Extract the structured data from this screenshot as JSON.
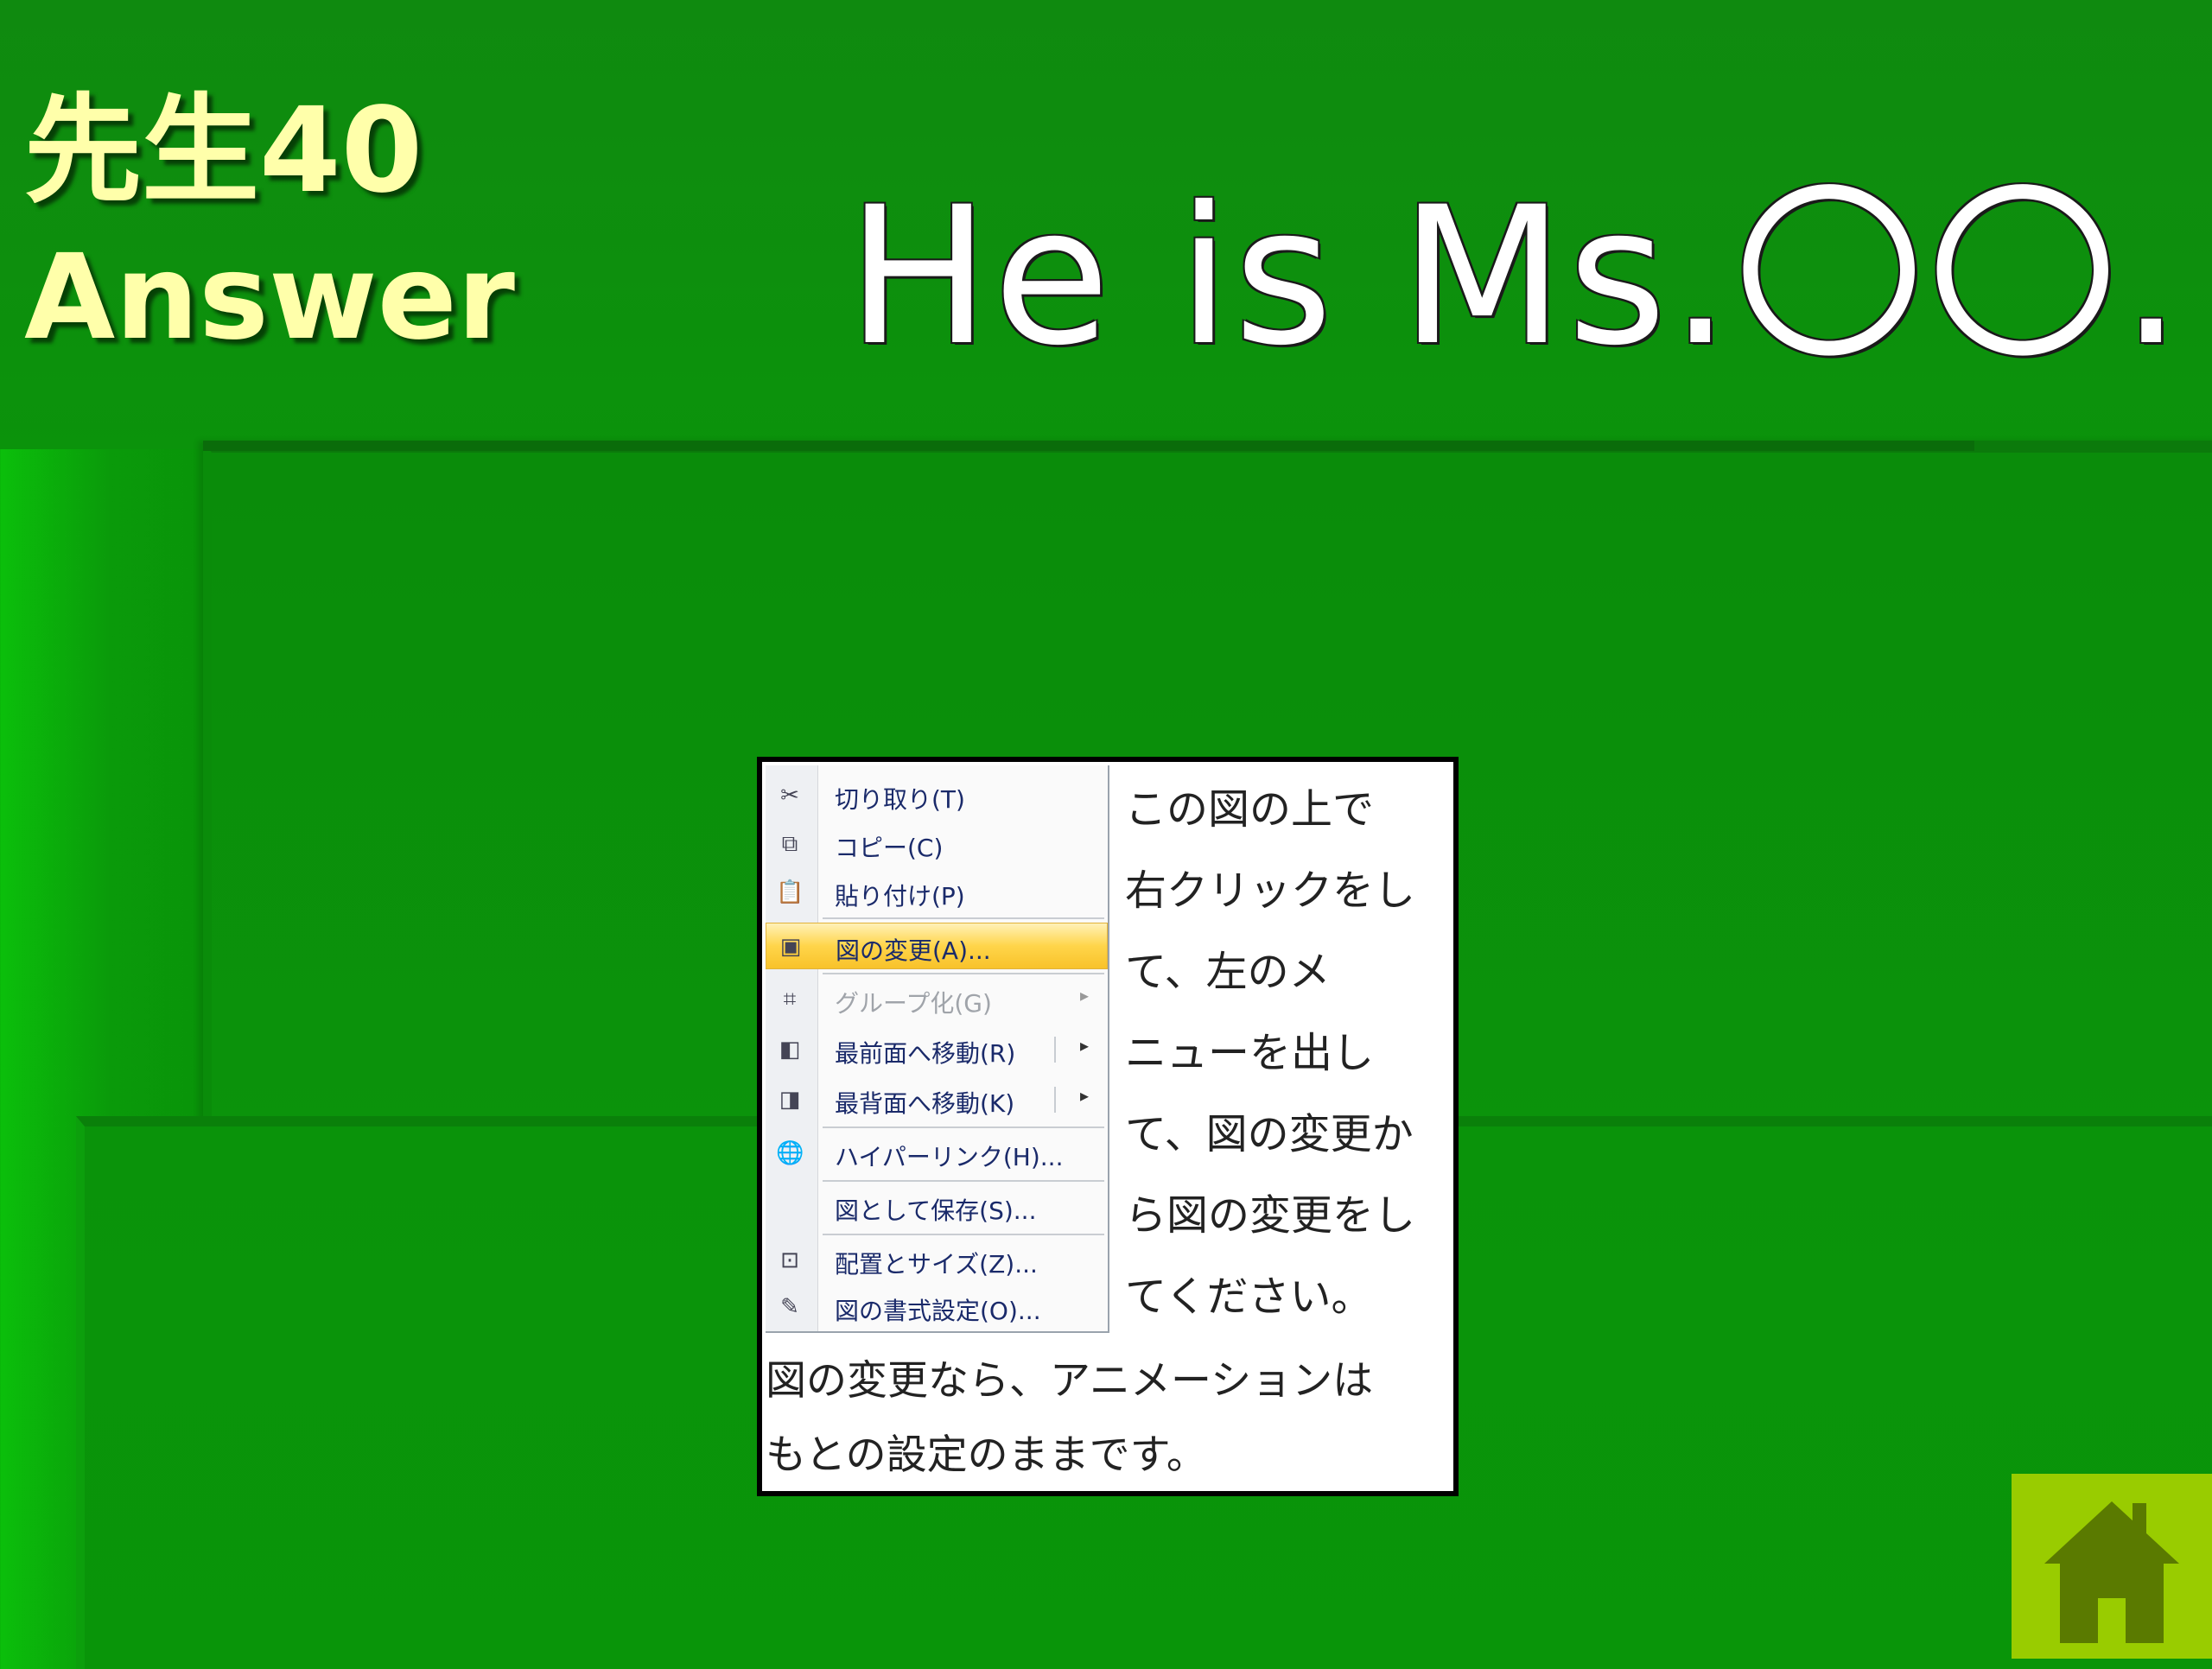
{
  "slide": {
    "title_line1": "先生40",
    "title_line2": "Answer",
    "answer": "He is Ms.〇〇."
  },
  "context_menu": {
    "items": [
      {
        "label": "切り取り(T)",
        "icon": "scissors-icon"
      },
      {
        "label": "コピー(C)",
        "icon": "copy-icon"
      },
      {
        "label": "貼り付け(P)",
        "icon": "paste-icon"
      },
      {
        "label": "図の変更(A)...",
        "icon": "change-picture-icon",
        "state": "highlighted"
      },
      {
        "label": "グループ化(G)",
        "icon": "group-icon",
        "state": "disabled",
        "submenu": true
      },
      {
        "label": "最前面へ移動(R)",
        "icon": "bring-to-front-icon",
        "submenu": true
      },
      {
        "label": "最背面へ移動(K)",
        "icon": "send-to-back-icon",
        "submenu": true
      },
      {
        "label": "ハイパーリンク(H)...",
        "icon": "hyperlink-icon"
      },
      {
        "label": "図として保存(S)...",
        "icon": ""
      },
      {
        "label": "配置とサイズ(Z)...",
        "icon": "size-position-icon"
      },
      {
        "label": "図の書式設定(O)...",
        "icon": "format-picture-icon"
      }
    ]
  },
  "instructions": {
    "side_lines": [
      "この図の上で",
      "右クリックをし",
      "て、左のメ",
      "ニューを出し",
      "て、図の変更か",
      "ら図の変更をし",
      "てください。"
    ],
    "bottom_lines": [
      "図の変更なら、アニメーションは",
      "もとの設定のままです。"
    ]
  },
  "home_button": {
    "icon": "home-icon"
  },
  "colors": {
    "background": "#088c08",
    "title": "#ffffaa",
    "home_button_bg": "#99cc00",
    "home_icon": "#5a7a00",
    "menu_highlight": "#ffd54a"
  }
}
